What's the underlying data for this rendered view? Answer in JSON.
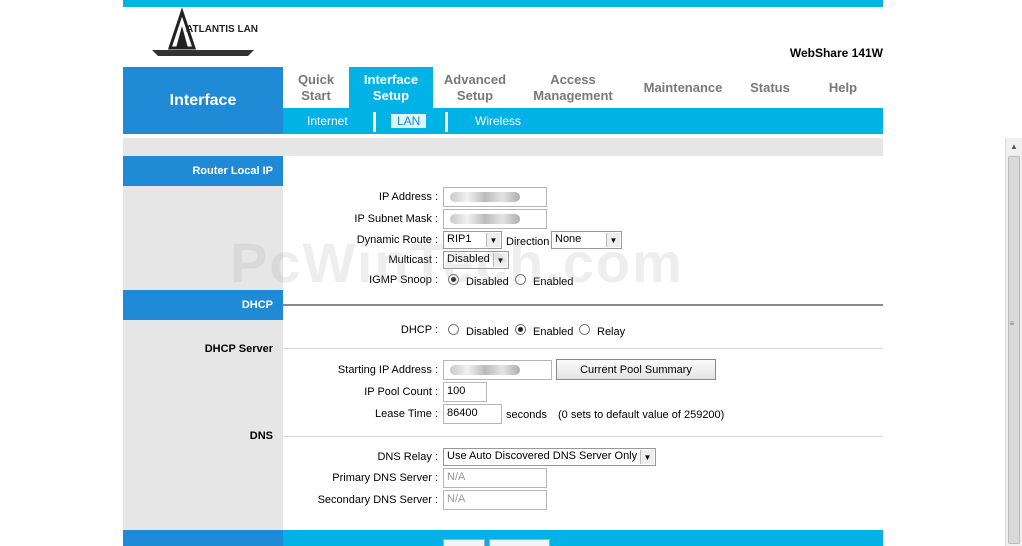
{
  "header": {
    "logo_text": "ATLANTIS LAND",
    "model": "WebShare 141W",
    "section_title": "Interface"
  },
  "tabs": [
    {
      "line1": "Quick",
      "line2": "Start"
    },
    {
      "line1": "Interface",
      "line2": "Setup"
    },
    {
      "line1": "Advanced",
      "line2": "Setup"
    },
    {
      "line1": "Access",
      "line2": "Management"
    },
    {
      "line1": "Maintenance",
      "line2": ""
    },
    {
      "line1": "Status",
      "line2": ""
    },
    {
      "line1": "Help",
      "line2": ""
    }
  ],
  "subtabs": [
    "Internet",
    "LAN",
    "Wireless"
  ],
  "sections": {
    "router_local_ip": "Router Local IP",
    "dhcp": "DHCP",
    "dhcp_server": "DHCP Server",
    "dns": "DNS"
  },
  "router": {
    "ip_address_label": "IP Address :",
    "subnet_label": "IP Subnet Mask :",
    "dynamic_route_label": "Dynamic Route :",
    "dynamic_route_value": "RIP1",
    "direction_label": "Direction",
    "direction_value": "None",
    "multicast_label": "Multicast :",
    "multicast_value": "Disabled",
    "igmp_label": "IGMP Snoop :",
    "igmp_disabled": "Disabled",
    "igmp_enabled": "Enabled"
  },
  "dhcp": {
    "dhcp_label": "DHCP :",
    "opt_disabled": "Disabled",
    "opt_enabled": "Enabled",
    "opt_relay": "Relay",
    "starting_ip_label": "Starting IP Address :",
    "pool_summary_button": "Current Pool Summary",
    "pool_count_label": "IP Pool Count :",
    "pool_count_value": "100",
    "lease_label": "Lease Time :",
    "lease_value": "86400",
    "lease_unit": "seconds",
    "lease_note": "(0 sets to default value of 259200)"
  },
  "dns": {
    "relay_label": "DNS Relay :",
    "relay_value": "Use Auto Discovered DNS Server Only",
    "primary_label": "Primary DNS Server :",
    "primary_value": "N/A",
    "secondary_label": "Secondary DNS Server :",
    "secondary_value": "N/A"
  },
  "watermark": "PcWinTech.com"
}
